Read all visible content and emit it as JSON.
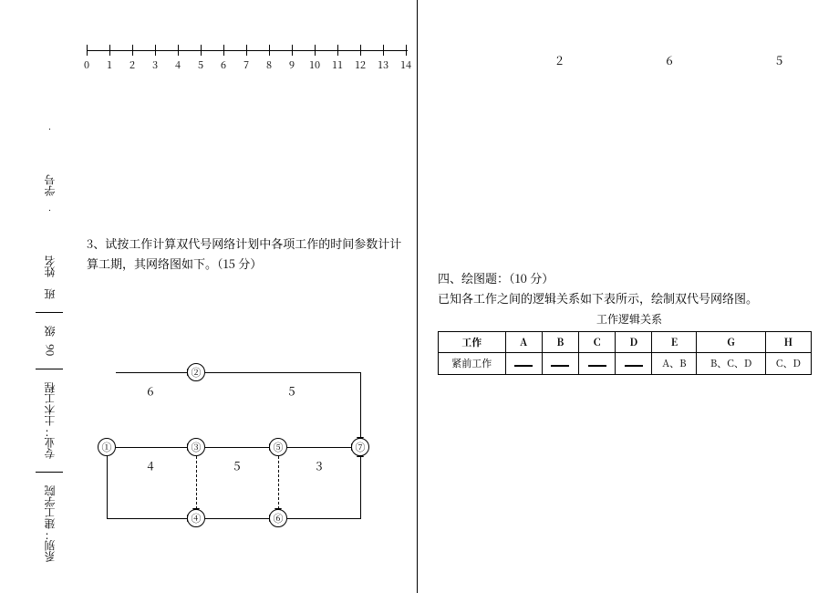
{
  "side": {
    "dept_label": "系别：",
    "dept_value": "建工学院",
    "major_label": "专业：",
    "major_value": "土木工程",
    "grade_value": "06",
    "grade_label": "级",
    "class_label": "班",
    "name_label": "姓名",
    "id_label": "学号"
  },
  "timeline": {
    "ticks": [
      "0",
      "1",
      "2",
      "3",
      "4",
      "5",
      "6",
      "7",
      "8",
      "9",
      "10",
      "11",
      "12",
      "13",
      "14"
    ]
  },
  "q3_text": "3、试按工作计算双代号网络计划中各项工作的时间参数计计算工期，其网络图如下。（15 分）",
  "net": {
    "n1": "①",
    "n2": "②",
    "n3": "③",
    "n4": "④",
    "n5": "⑤",
    "n6": "⑥",
    "n7": "⑦",
    "e12": "6",
    "e13": "4",
    "e35": "5",
    "e57": "3",
    "e27": "5"
  },
  "rvals": {
    "a": "2",
    "b": "6",
    "c": "5"
  },
  "q4": {
    "title": "四、绘图题：（10 分）",
    "desc": "已知各工作之间的逻辑关系如下表所示，绘制双代号网络图。",
    "caption": "工作逻辑关系",
    "h_work": "工作",
    "h_pre": "紧前工作",
    "cols": [
      "A",
      "B",
      "C",
      "D",
      "E",
      "G",
      "H"
    ],
    "pre": [
      "—",
      "—",
      "—",
      "—",
      "A、B",
      "B、C、D",
      "C、D"
    ]
  }
}
